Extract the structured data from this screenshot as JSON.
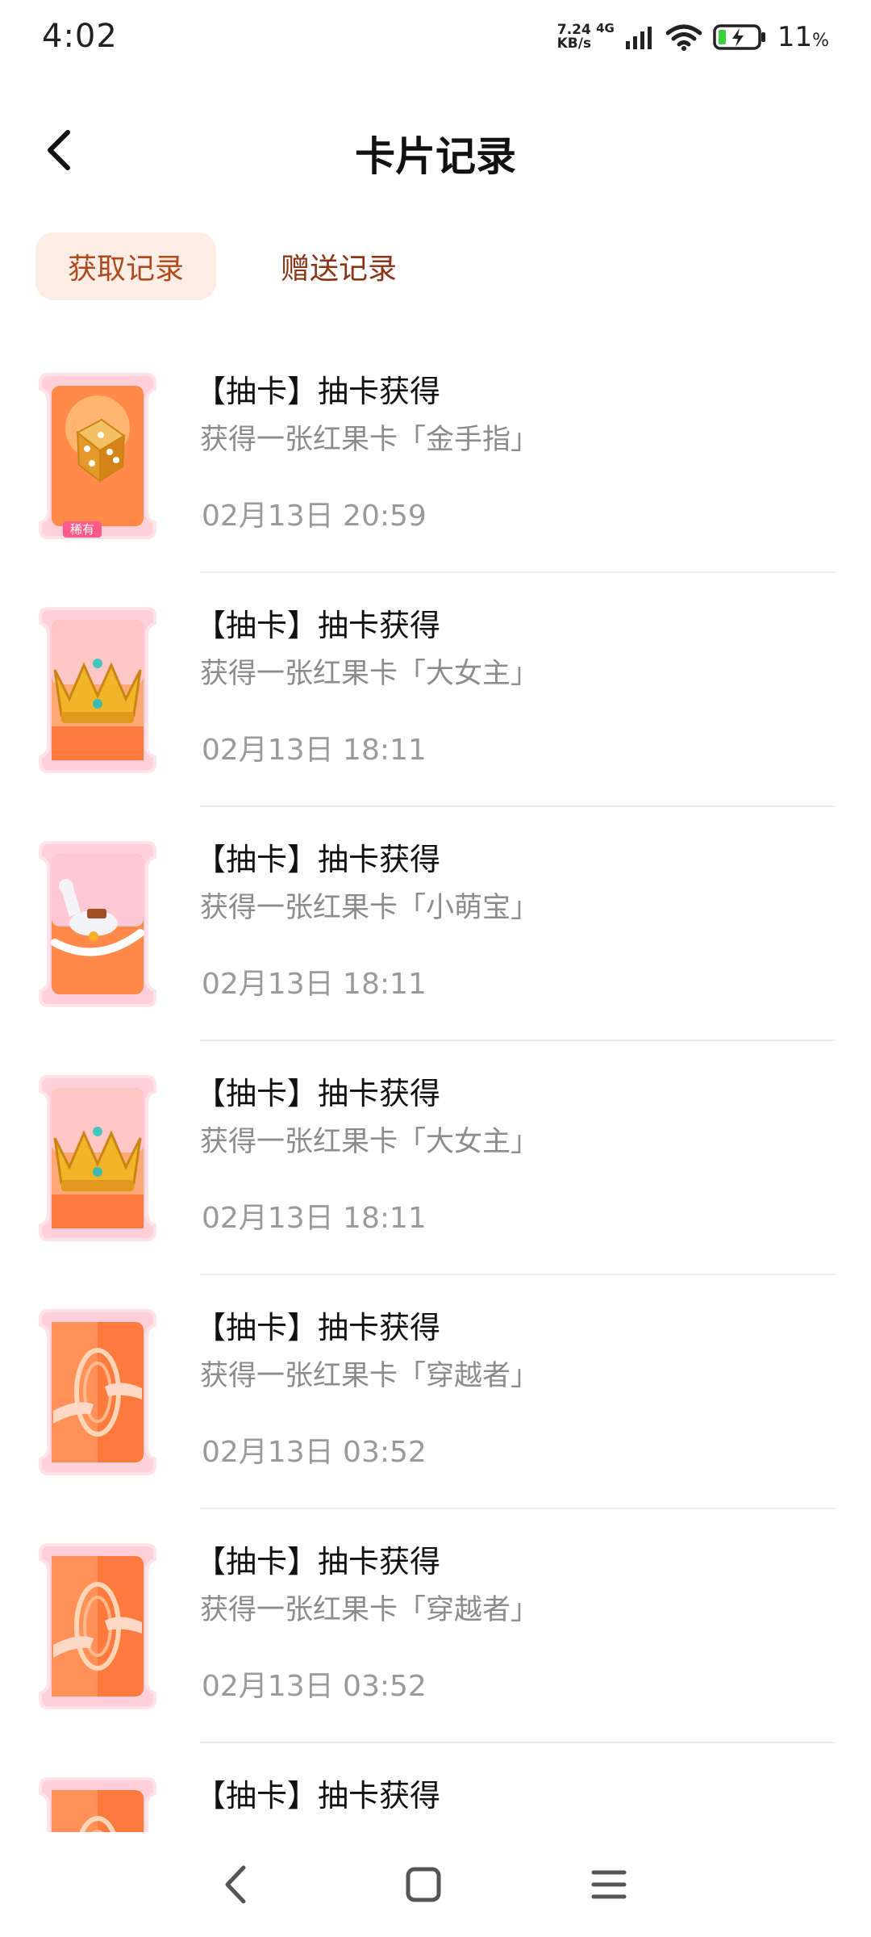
{
  "status_bar": {
    "time": "4:02",
    "net_speed_value": "7.24",
    "net_speed_unit": "KB/s",
    "network_type": "4G",
    "battery_percent": "11",
    "battery_unit": "%"
  },
  "header": {
    "title": "卡片记录"
  },
  "tabs": [
    {
      "label": "获取记录",
      "active": true
    },
    {
      "label": "赠送记录",
      "active": false
    }
  ],
  "records": [
    {
      "title": "【抽卡】抽卡获得",
      "desc": "获得一张红果卡「金手指」",
      "time": "02月13日 20:59",
      "card_icon": "dice-icon",
      "badge": "稀有"
    },
    {
      "title": "【抽卡】抽卡获得",
      "desc": "获得一张红果卡「大女主」",
      "time": "02月13日 18:11",
      "card_icon": "crown-icon"
    },
    {
      "title": "【抽卡】抽卡获得",
      "desc": "获得一张红果卡「小萌宝」",
      "time": "02月13日 18:11",
      "card_icon": "rocking-horse-icon"
    },
    {
      "title": "【抽卡】抽卡获得",
      "desc": "获得一张红果卡「大女主」",
      "time": "02月13日 18:11",
      "card_icon": "crown-icon"
    },
    {
      "title": "【抽卡】抽卡获得",
      "desc": "获得一张红果卡「穿越者」",
      "time": "02月13日 03:52",
      "card_icon": "portal-hands-icon"
    },
    {
      "title": "【抽卡】抽卡获得",
      "desc": "获得一张红果卡「穿越者」",
      "time": "02月13日 03:52",
      "card_icon": "portal-hands-icon"
    },
    {
      "title": "【抽卡】抽卡获得",
      "desc": "",
      "time": "",
      "card_icon": "portal-hands-icon"
    }
  ],
  "colors": {
    "accent": "#b04a1e",
    "tab_active_bg": "#fdeee5",
    "card_orange": "#ff7a3d",
    "card_pink": "#ffc3cf"
  }
}
